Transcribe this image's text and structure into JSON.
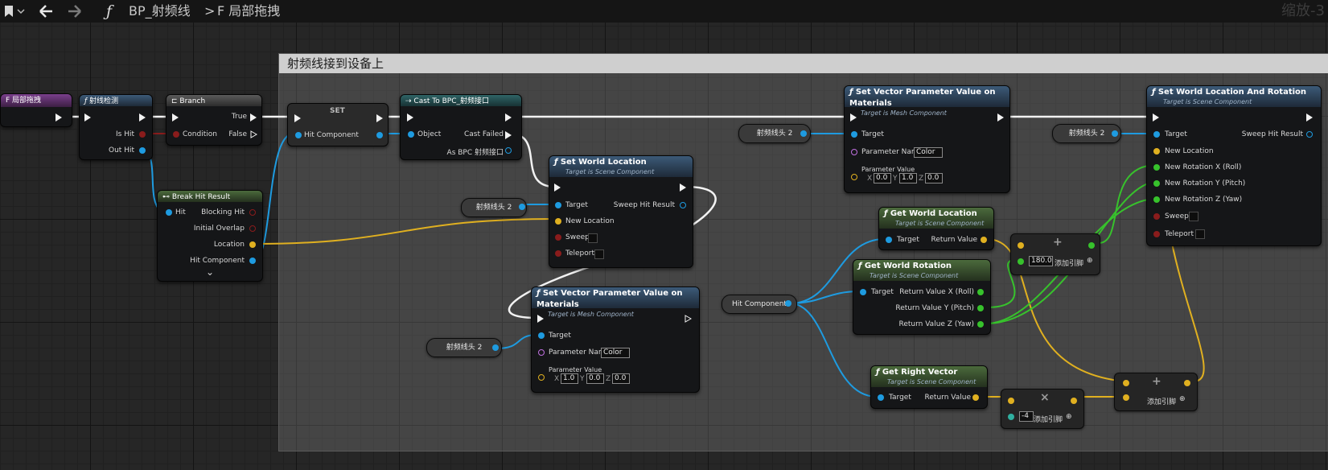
{
  "topbar": {
    "bookmark_icon": "bookmark-icon",
    "dropdown_icon": "chevron-down-icon",
    "back_icon": "arrow-left-icon",
    "forward_icon": "arrow-right-icon",
    "function_glyph": "ƒ",
    "blueprint_name": "BP_射频线",
    "separator": ">",
    "function_name": "F 局部拖拽",
    "zoom_label": "缩放-3"
  },
  "comment": {
    "title": "射频线接到设备上"
  },
  "nodes": {
    "entry": {
      "title": "F 局部拖拽"
    },
    "ray": {
      "glyph": "ƒ",
      "title": "射线检测",
      "is_hit": "Is Hit",
      "out_hit": "Out Hit"
    },
    "branch": {
      "title": "Branch",
      "condition": "Condition",
      "true": "True",
      "false": "False"
    },
    "break": {
      "title": "Break Hit Result",
      "hit": "Hit",
      "blocking": "Blocking Hit",
      "overlap": "Initial Overlap",
      "location": "Location",
      "hit_component": "Hit Component",
      "expand": "⌄"
    },
    "set": {
      "title": "SET",
      "hit_component": "Hit Component"
    },
    "cast": {
      "title": "Cast To BPC_射频接口",
      "object": "Object",
      "cast_failed": "Cast Failed",
      "as": "As BPC 射频接口"
    },
    "swl": {
      "glyph": "ƒ",
      "title": "Set World Location",
      "subtitle": "Target is Scene Component",
      "target": "Target",
      "new_location": "New Location",
      "sweep": "Sweep",
      "teleport": "Teleport",
      "sweep_hit": "Sweep Hit Result"
    },
    "svp1": {
      "glyph": "ƒ",
      "title": "Set Vector Parameter Value on Materials",
      "subtitle": "Target is Mesh Component",
      "target": "Target",
      "param_name": "Parameter Name",
      "param_name_value": "Color",
      "param_value": "Parameter Value",
      "x": "X",
      "x_val": "1.0",
      "y": "Y",
      "y_val": "0.0",
      "z": "Z",
      "z_val": "0.0"
    },
    "svp2": {
      "glyph": "ƒ",
      "title": "Set Vector Parameter Value on Materials",
      "subtitle": "Target is Mesh Component",
      "target": "Target",
      "param_name": "Parameter Name",
      "param_name_value": "Color",
      "param_value": "Parameter Value",
      "x": "X",
      "x_val": "0.0",
      "y": "Y",
      "y_val": "1.0",
      "z": "Z",
      "z_val": "0.0"
    },
    "gwl": {
      "glyph": "ƒ",
      "title": "Get World Location",
      "subtitle": "Target is Scene Component",
      "target": "Target",
      "ret": "Return Value"
    },
    "gwr": {
      "glyph": "ƒ",
      "title": "Get World Rotation",
      "subtitle": "Target is Scene Component",
      "target": "Target",
      "rx": "Return Value X (Roll)",
      "ry": "Return Value Y (Pitch)",
      "rz": "Return Value Z (Yaw)"
    },
    "grv": {
      "glyph": "ƒ",
      "title": "Get Right Vector",
      "subtitle": "Target is Scene Component",
      "target": "Target",
      "ret": "Return Value"
    },
    "swlr": {
      "glyph": "ƒ",
      "title": "Set World Location And Rotation",
      "subtitle": "Target is Scene Component",
      "target": "Target",
      "new_location": "New Location",
      "rx": "New Rotation X (Roll)",
      "ry": "New Rotation Y (Pitch)",
      "rz": "New Rotation Z (Yaw)",
      "sweep": "Sweep",
      "teleport": "Teleport",
      "sweep_hit": "Sweep Hit Result"
    },
    "add1": {
      "symbol": "+",
      "value": "180.0",
      "add_pin": "添加引脚"
    },
    "mul": {
      "symbol": "×",
      "value": "-4",
      "add_pin": "添加引脚"
    },
    "add2": {
      "symbol": "+",
      "add_pin": "添加引脚"
    },
    "var_swl": "射频线头 2",
    "var_svp1": "射频线头 2",
    "var_svp2": "射频线头 2",
    "var_swlr": "射频线头 2",
    "var_hit": "Hit Component"
  },
  "colors": {
    "exec": "#f2f2f2",
    "object": "#1e9be0",
    "vector": "#e0b020",
    "float": "#37c22c",
    "bool": "#8a1c1c",
    "name": "#c070e0"
  }
}
